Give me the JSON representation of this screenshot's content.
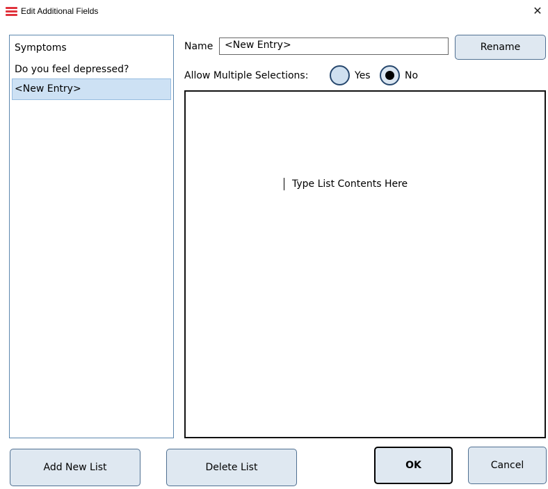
{
  "window": {
    "title": "Edit Additional Fields",
    "close_glyph": "✕"
  },
  "list": {
    "items": [
      {
        "label": "Symptoms",
        "selected": false
      },
      {
        "label": "Do you feel depressed?",
        "selected": false
      },
      {
        "label": "<New Entry>",
        "selected": true
      }
    ]
  },
  "name_field": {
    "label": "Name",
    "value": "<New Entry>"
  },
  "rename_button": "Rename",
  "multiple_selection": {
    "label": "Allow Multiple Selections:",
    "options": [
      {
        "label": "Yes",
        "checked": false
      },
      {
        "label": "No",
        "checked": true
      }
    ]
  },
  "list_contents": {
    "placeholder": "Type List Contents Here"
  },
  "buttons": {
    "add": "Add New List",
    "delete": "Delete List",
    "ok": "OK",
    "cancel": "Cancel"
  },
  "colors": {
    "accent_icon": "#e0323c",
    "selected_row": "#cde1f4",
    "button_face": "#dfe8f1"
  }
}
